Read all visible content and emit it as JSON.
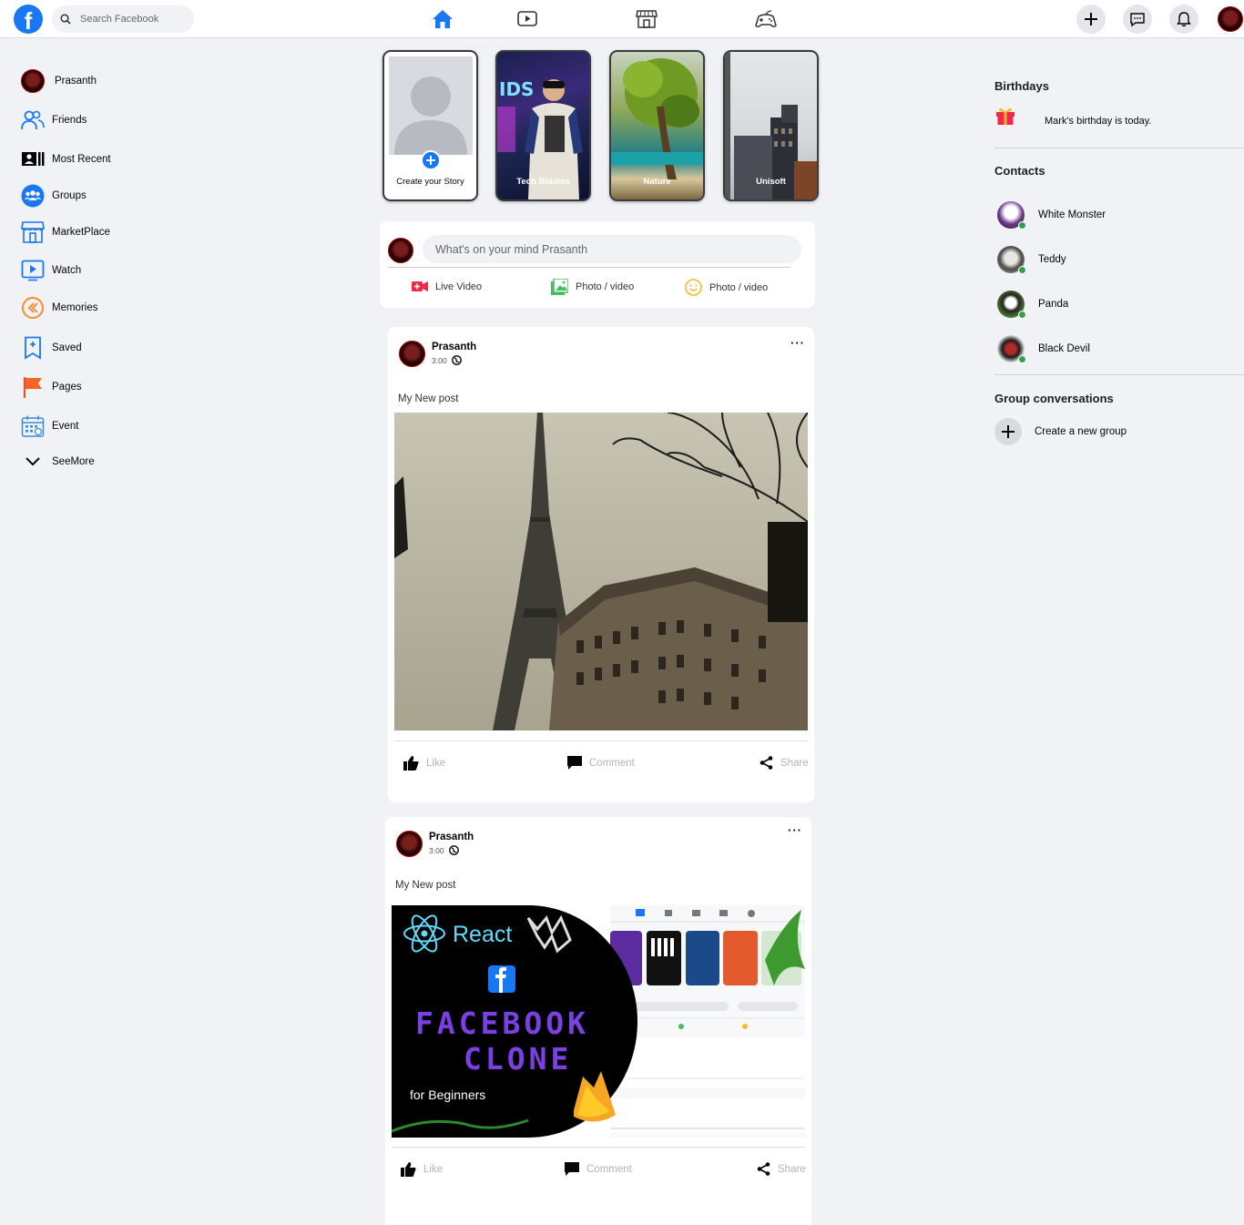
{
  "topbar": {
    "logo": "f",
    "search_placeholder": "Search Facebook",
    "nav_icons": [
      "home-icon",
      "watch-icon",
      "marketplace-icon",
      "gaming-icon"
    ],
    "right_icons": [
      "plus-icon",
      "messenger-icon",
      "bell-icon",
      "profile-avatar"
    ],
    "accent": "#1877f2"
  },
  "sidebar": {
    "items": [
      {
        "label": "Prasanth",
        "icon": "profile-avatar"
      },
      {
        "label": "Friends",
        "icon": "friends-icon"
      },
      {
        "label": "Most Recent",
        "icon": "most-recent-icon"
      },
      {
        "label": "Groups",
        "icon": "groups-icon"
      },
      {
        "label": "MarketPlace",
        "icon": "marketplace-icon"
      },
      {
        "label": "Watch",
        "icon": "watch-icon"
      },
      {
        "label": "Memories",
        "icon": "memories-icon"
      },
      {
        "label": "Saved",
        "icon": "saved-icon"
      },
      {
        "label": "Pages",
        "icon": "pages-flag-icon"
      },
      {
        "label": "Event",
        "icon": "event-calendar-icon"
      },
      {
        "label": "SeeMore",
        "icon": "chevron-down-icon"
      }
    ]
  },
  "stories": [
    {
      "label": "Create your Story"
    },
    {
      "label": "Tech Biddies"
    },
    {
      "label": "Nature"
    },
    {
      "label": "Unisoft"
    }
  ],
  "composer": {
    "placeholder": "What's on your mind Prasanth",
    "actions": [
      {
        "label": "Live Video",
        "icon": "live-video-icon"
      },
      {
        "label": "Photo / video",
        "icon": "photo-icon"
      },
      {
        "label": "Photo / video",
        "icon": "smiley-icon"
      }
    ]
  },
  "posts": [
    {
      "author": "Prasanth",
      "time": "3:00",
      "text": "My New post",
      "image": "eiffel-tower-photo",
      "actions": {
        "like": "Like",
        "comment": "Comment",
        "share": "Share"
      }
    },
    {
      "author": "Prasanth",
      "time": "3:00",
      "text": "My New post",
      "image": "facebook-clone-thumbnail",
      "thumbnail_text": {
        "react": "React",
        "title1": "FACEBOOK",
        "title2": "CLONE",
        "sub": "for Beginners"
      },
      "actions": {
        "like": "Like",
        "comment": "Comment",
        "share": "Share"
      }
    }
  ],
  "right": {
    "birthdays_title": "Birthdays",
    "birthday_text": "Mark's birthday is today.",
    "contacts_title": "Contacts",
    "contacts": [
      {
        "name": "White Monster",
        "online": true
      },
      {
        "name": "Teddy",
        "online": true
      },
      {
        "name": "Panda",
        "online": true
      },
      {
        "name": "Black Devil",
        "online": true
      }
    ],
    "groups_title": "Group conversations",
    "create_group": "Create a new group"
  }
}
